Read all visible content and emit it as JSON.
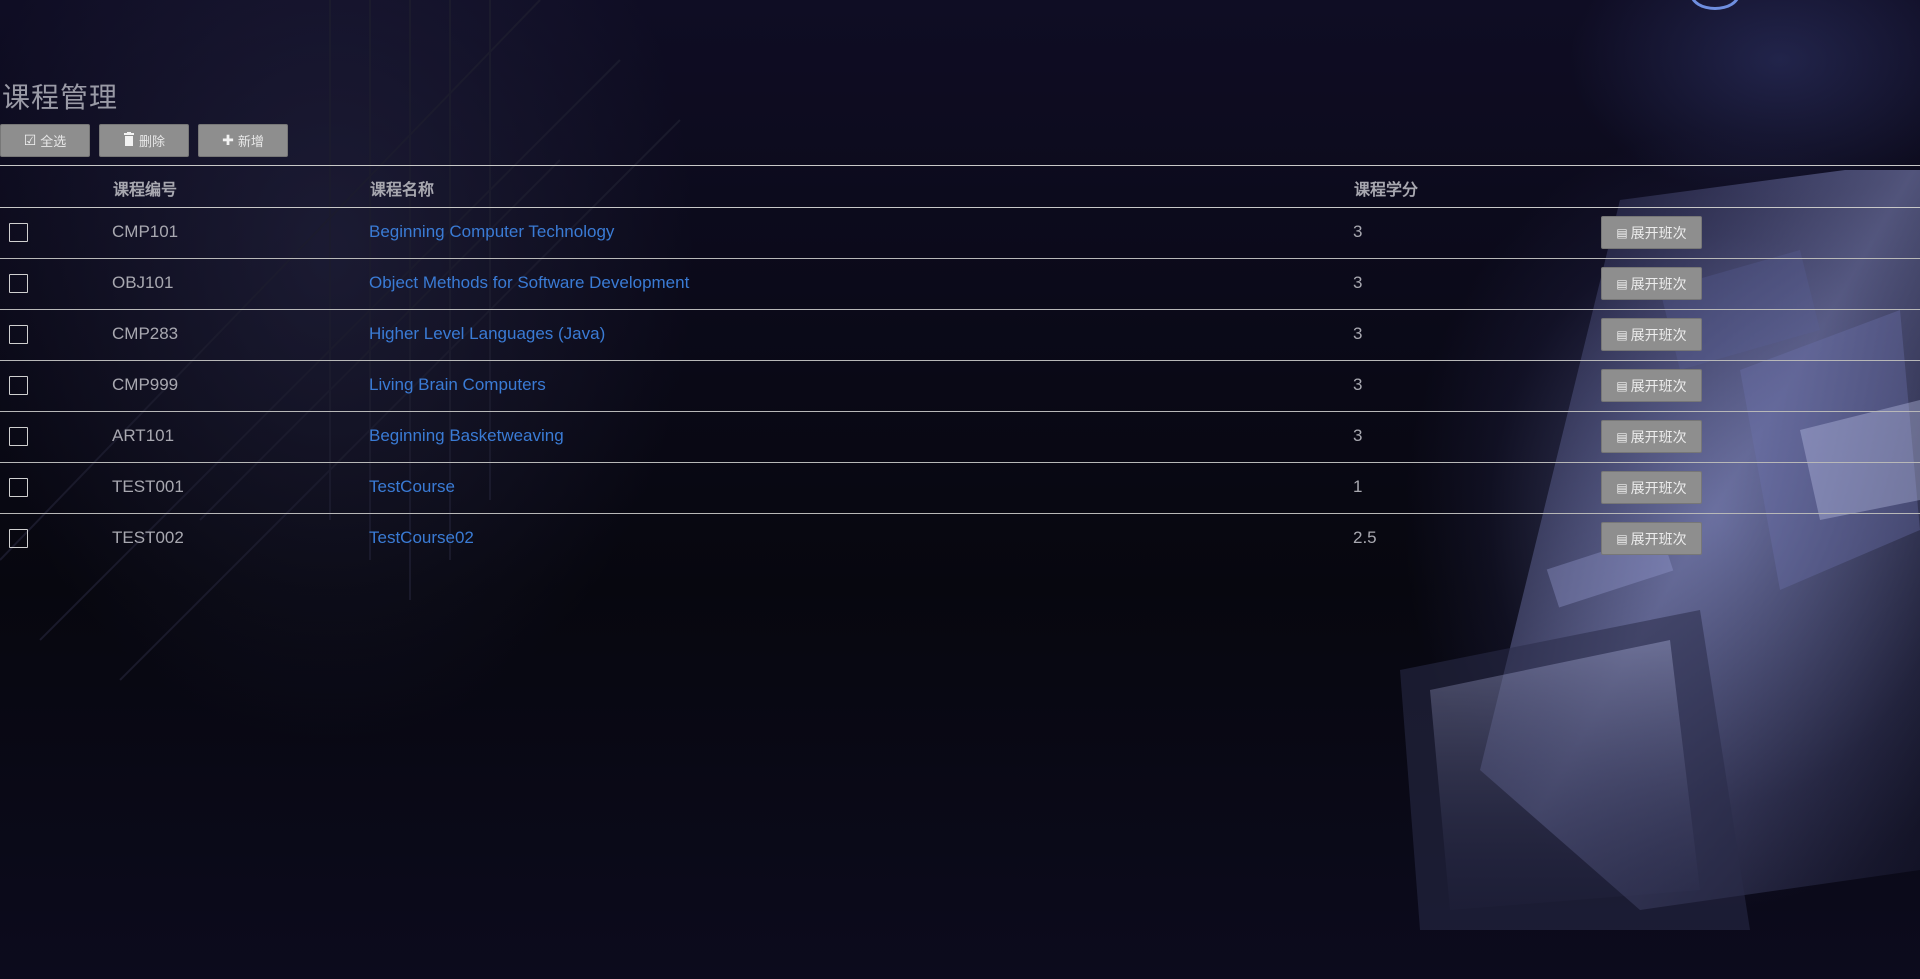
{
  "page": {
    "title": "课程管理"
  },
  "toolbar": {
    "select_all_label": "全选",
    "delete_label": "删除",
    "add_label": "新增"
  },
  "table": {
    "headers": {
      "code": "课程编号",
      "name": "课程名称",
      "credit": "课程学分"
    },
    "action_label": "展开班次",
    "rows": [
      {
        "code": "CMP101",
        "name": "Beginning Computer Technology",
        "credit": "3"
      },
      {
        "code": "OBJ101",
        "name": "Object Methods for Software Development",
        "credit": "3"
      },
      {
        "code": "CMP283",
        "name": "Higher Level Languages (Java)",
        "credit": "3"
      },
      {
        "code": "CMP999",
        "name": "Living Brain Computers",
        "credit": "3"
      },
      {
        "code": "ART101",
        "name": "Beginning Basketweaving",
        "credit": "3"
      },
      {
        "code": "TEST001",
        "name": "TestCourse",
        "credit": "1"
      },
      {
        "code": "TEST002",
        "name": "TestCourse02",
        "credit": "2.5"
      }
    ]
  },
  "icons": {
    "select_all": "check-square-icon",
    "delete": "trash-icon",
    "add": "plus-icon",
    "expand": "list-icon"
  },
  "colors": {
    "link": "#3a7bd5",
    "button_bg": "#8e8e8e",
    "text_muted": "#a8a8b0"
  }
}
